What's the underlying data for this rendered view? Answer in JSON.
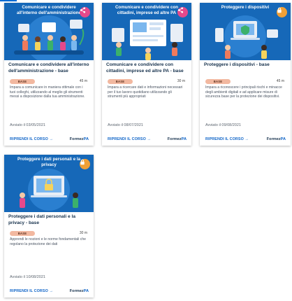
{
  "cards": [
    {
      "hero_title": "Comunicare e condividere all'interno dell'amministrazione",
      "action_icon": "share-icon",
      "title": "Comunicare e condividere all'interno dell'amministrazione - base",
      "level": "BASE",
      "duration": "45 m",
      "description": "Impara a comunicare in maniera ottimale con i tuoi colleghi, utilizzando al meglio gli strumenti messi a disposizione dalla tua amministrazione.",
      "start": "Avviato il 03/05/2021",
      "cta": "RIPRENDI IL CORSO →",
      "brand_main": "Formez",
      "brand_accent": "PA"
    },
    {
      "hero_title": "Comunicare e condividere con cittadini, imprese ed altre PA",
      "action_icon": "share-icon",
      "title": "Comunicare e condividere con cittadini, imprese ed altre PA - base",
      "level": "BASE",
      "duration": "30 m",
      "description": "Impara a ricercare dati e informazioni necessari per il tuo lavoro quotidiano utilizzando gli strumenti più appropriati",
      "start": "Avviato il 08/07/2021",
      "cta": "RIPRENDI IL CORSO →",
      "brand_main": "Formez",
      "brand_accent": "PA"
    },
    {
      "hero_title": "Proteggere i dispositivi",
      "action_icon": "lock-icon",
      "title": "Proteggere i dispositivi - base",
      "level": "BASE",
      "duration": "45 m",
      "description": "Impara a riconoscere i principali rischi e minacce degli ambienti digitali e ad applicare misure di sicurezza base per la protezione dei dispositivi.",
      "start": "Avviato il 09/08/2021",
      "cta": "RIPRENDI IL CORSO →",
      "brand_main": "Formez",
      "brand_accent": "PA"
    },
    {
      "hero_title": "Proteggere i dati personali e la privacy",
      "action_icon": "lock-icon",
      "title": "Proteggere i dati personali e la privacy - base",
      "level": "BASE",
      "duration": "30 m",
      "description": "Apprendi le nozioni e le norme fondamentali che regolano la protezione dei dati",
      "start": "Avviato il 10/08/2021",
      "cta": "RIPRENDI IL CORSO →",
      "brand_main": "Formez",
      "brand_accent": "PA"
    }
  ],
  "colors": {
    "hero": "#1668b8",
    "share": "#e6498b",
    "lock": "#f0a037",
    "badge": "#f2b8a0",
    "link": "#1065c8"
  }
}
